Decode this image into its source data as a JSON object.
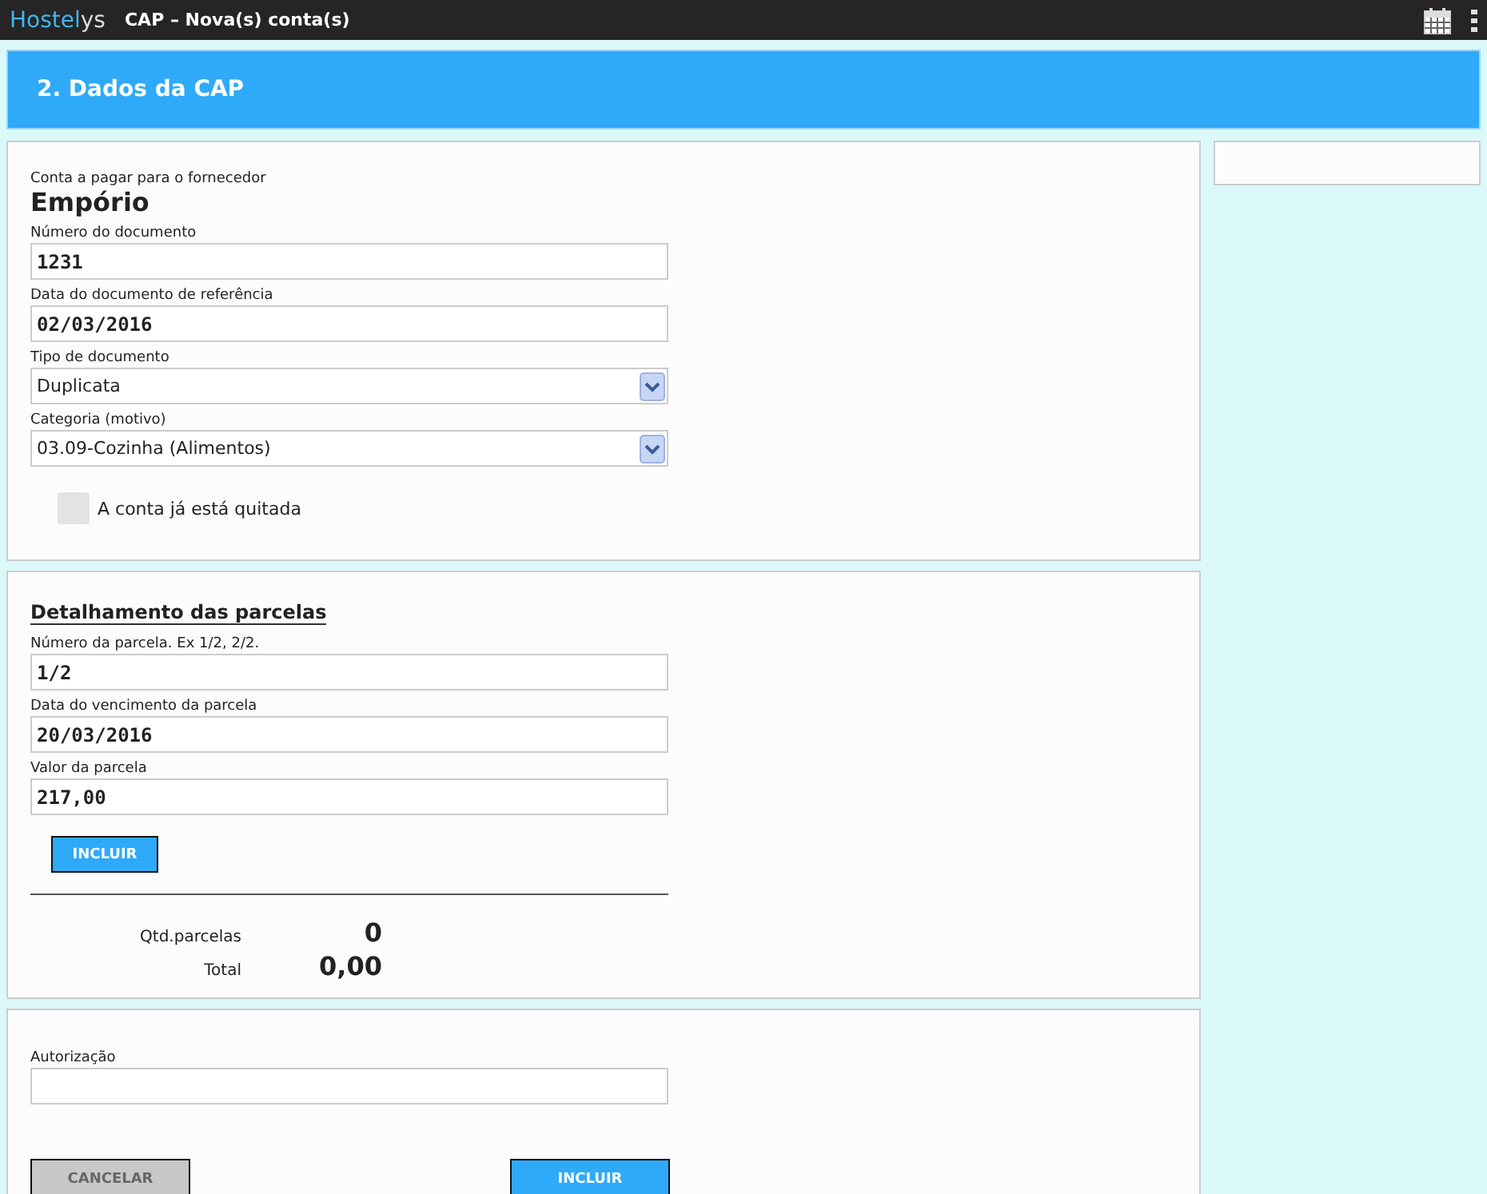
{
  "topbar": {
    "brand_a": "Hostel",
    "brand_b": "ys",
    "title": "CAP – Nova(s) conta(s)"
  },
  "header": {
    "title": "2. Dados da CAP"
  },
  "supplier": {
    "caption": "Conta a pagar para o fornecedor",
    "name": "Empório"
  },
  "document_fields": [
    {
      "kind": "text",
      "label": "Número do documento",
      "value": "1231"
    },
    {
      "kind": "text",
      "label": "Data do documento de referência",
      "value": "02/03/2016"
    },
    {
      "kind": "select",
      "label": "Tipo de documento",
      "value": "Duplicata"
    },
    {
      "kind": "select",
      "label": "Categoria (motivo)",
      "value": "03.09-Cozinha (Alimentos)"
    }
  ],
  "paid_checkbox": {
    "label": "A conta já está quitada",
    "checked": false
  },
  "installments": {
    "title": "Detalhamento das parcelas",
    "fields": [
      {
        "kind": "text",
        "label": "Número da parcela. Ex 1/2, 2/2.",
        "value": "1/2"
      },
      {
        "kind": "text",
        "label": "Data do vencimento da parcela",
        "value": "20/03/2016"
      },
      {
        "kind": "text",
        "label": "Valor da parcela",
        "value": "217,00"
      }
    ],
    "add_button": "INCLUIR",
    "summary": [
      {
        "label": "Qtd.parcelas",
        "value": "0"
      },
      {
        "label": "Total",
        "value": "0,00"
      }
    ]
  },
  "authorization": {
    "label": "Autorização"
  },
  "cancel_button": "CANCELAR",
  "submit_button": "INCLUIR"
}
